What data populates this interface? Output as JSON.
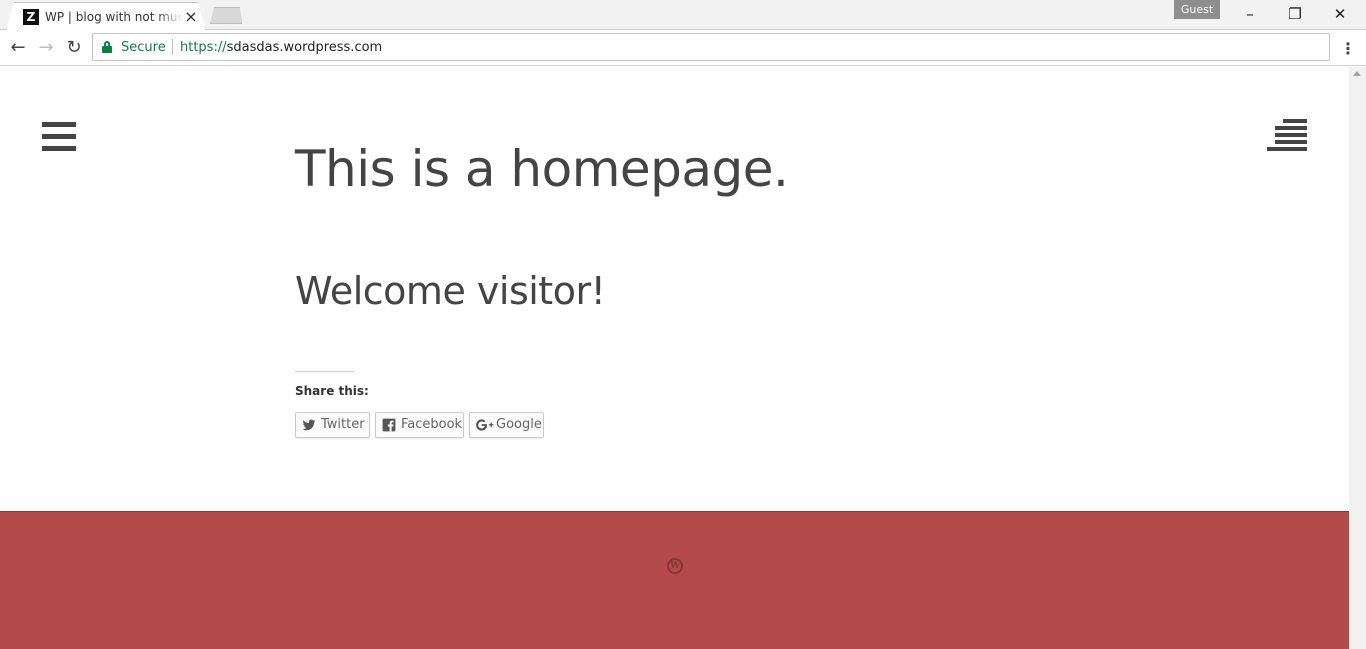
{
  "browser": {
    "tab": {
      "favicon_letter": "Z",
      "title": "WP | blog with not much",
      "close_glyph": "×"
    },
    "profile_label": "Guest",
    "window_controls": {
      "minimize": "–",
      "restore": "❐",
      "close": "✕"
    },
    "nav": {
      "back": "←",
      "forward": "→",
      "reload": "↻"
    },
    "address": {
      "security_label": "Secure",
      "scheme": "https://",
      "host": "sdasdas.wordpress.com"
    },
    "menu_glyph": "⋮"
  },
  "page": {
    "title": "This is a homepage.",
    "welcome": "Welcome visitor!",
    "share": {
      "label": "Share this:",
      "buttons": [
        {
          "label": "Twitter",
          "icon": "twitter-icon",
          "glyph": "🐦"
        },
        {
          "label": "Facebook",
          "icon": "facebook-icon",
          "glyph": "f"
        },
        {
          "label": "Google",
          "icon": "google-plus-icon",
          "glyph": "G+"
        }
      ]
    },
    "footer": {
      "logo_icon": "wordpress-icon",
      "logo_glyph": "W"
    }
  },
  "colors": {
    "text": "#444444",
    "secure_green": "#0b8043",
    "footer_bg": "#b44b4b"
  }
}
